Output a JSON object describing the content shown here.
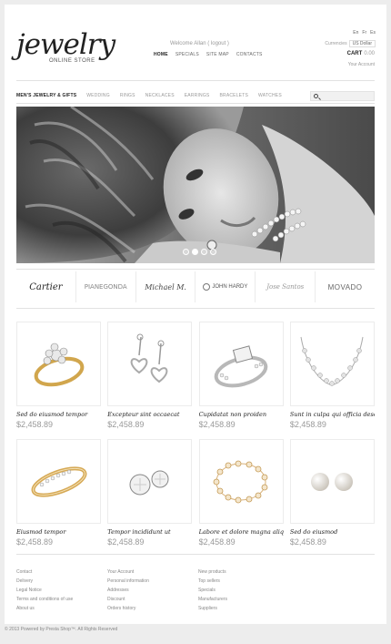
{
  "header": {
    "logo_word": "jewelry",
    "logo_sub": "ONLINE STORE",
    "welcome": "Welcome Allan ( logout )",
    "nav": [
      "HOME",
      "SPECIALS",
      "SITE MAP",
      "CONTACTS"
    ],
    "flags": [
      "En",
      "Fr",
      "Es"
    ],
    "currency_label": "Currencies",
    "currency_value": "US Dollar",
    "cart_label": "CART",
    "cart_value": "0.00",
    "account": "Your Account"
  },
  "menu": {
    "items": [
      "MEN'S JEWELRY & GIFTS",
      "WEDDING",
      "RINGS",
      "NECKLACES",
      "EARRINGS",
      "BRACELETS",
      "WATCHES"
    ]
  },
  "banner": {
    "slides": 4,
    "active": 2
  },
  "brands": [
    "Cartier",
    "PIANEGONDA",
    "Michael M.",
    "JOHN HARDY",
    "Jose Santos",
    "MOVADO"
  ],
  "products": [
    {
      "name": "Sed do eiusmod tempor",
      "price": "$2,458.89",
      "icon": "diamond-ring-icon"
    },
    {
      "name": "Excepteur sint occaecat",
      "price": "$2,458.89",
      "icon": "heart-earrings-icon"
    },
    {
      "name": "Cupidatat non proiden",
      "price": "$2,458.89",
      "icon": "silver-ring-icon"
    },
    {
      "name": "Sunt in culpa qui officia deseru",
      "price": "$2,458.89",
      "icon": "heart-necklace-icon"
    },
    {
      "name": "Eiusmod tempor",
      "price": "$2,458.89",
      "icon": "gold-band-icon"
    },
    {
      "name": "Tempor incididunt ut",
      "price": "$2,458.89",
      "icon": "stud-earrings-icon"
    },
    {
      "name": "Labore et dolore magna aliqu",
      "price": "$2,458.89",
      "icon": "bracelet-icon"
    },
    {
      "name": "Sed do eiusmod",
      "price": "$2,458.89",
      "icon": "pearl-earrings-icon"
    }
  ],
  "footer": {
    "col1": [
      "Contact",
      "Delivery",
      "Legal Notice",
      "Terms and conditions of use",
      "About us"
    ],
    "col2": [
      "Your Account",
      "Personal information",
      "Addresses",
      "Discount",
      "Orders history"
    ],
    "col3": [
      "New products",
      "Top sellers",
      "Specials",
      "Manufacturers",
      "Suppliers"
    ],
    "copyright": "© 2013 Powered by Presta Shop™. All Rights Reserved"
  },
  "colors": {
    "background": "#ededed",
    "panel": "#ffffff",
    "text": "#222222",
    "muted": "#999999"
  }
}
